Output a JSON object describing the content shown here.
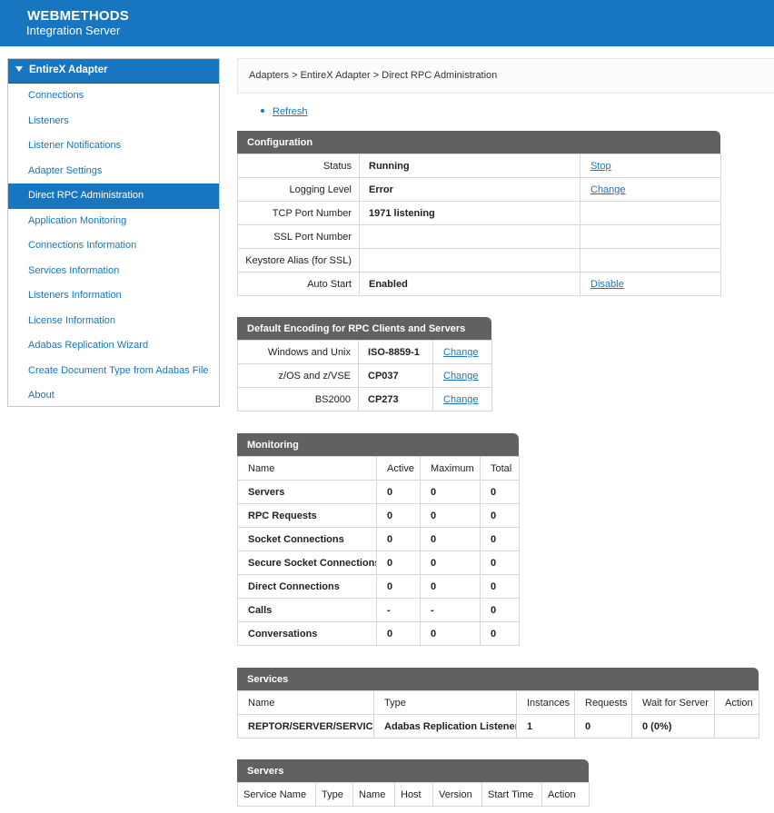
{
  "header": {
    "brand": "WEBMETHODS",
    "product": "Integration Server"
  },
  "sidebar": {
    "title": "EntireX Adapter",
    "items": [
      {
        "label": "Connections"
      },
      {
        "label": "Listeners"
      },
      {
        "label": "Listener Notifications"
      },
      {
        "label": "Adapter Settings"
      },
      {
        "label": "Direct RPC Administration",
        "active": true
      },
      {
        "label": "Application Monitoring"
      },
      {
        "label": "Connections Information"
      },
      {
        "label": "Services Information"
      },
      {
        "label": "Listeners Information"
      },
      {
        "label": "License Information"
      },
      {
        "label": "Adabas Replication Wizard"
      },
      {
        "label": "Create Document Type from Adabas File"
      },
      {
        "label": "About"
      }
    ]
  },
  "breadcrumb": "Adapters > EntireX Adapter > Direct RPC Administration",
  "refresh_label": "Refresh",
  "configuration": {
    "title": "Configuration",
    "rows": [
      {
        "label": "Status",
        "value": "Running",
        "action": "Stop"
      },
      {
        "label": "Logging Level",
        "value": "Error",
        "action": "Change"
      },
      {
        "label": "TCP Port Number",
        "value": "1971 listening",
        "action": ""
      },
      {
        "label": "SSL Port Number",
        "value": "",
        "action": ""
      },
      {
        "label": "Keystore Alias (for SSL)",
        "value": "",
        "action": ""
      },
      {
        "label": "Auto Start",
        "value": "Enabled",
        "action": "Disable"
      }
    ]
  },
  "encoding": {
    "title": "Default Encoding for RPC Clients and Servers",
    "rows": [
      {
        "label": "Windows and Unix",
        "value": "ISO-8859-1",
        "action": "Change"
      },
      {
        "label": "z/OS and z/VSE",
        "value": "CP037",
        "action": "Change"
      },
      {
        "label": "BS2000",
        "value": "CP273",
        "action": "Change"
      }
    ]
  },
  "monitoring": {
    "title": "Monitoring",
    "headers": [
      "Name",
      "Active",
      "Maximum",
      "Total"
    ],
    "rows": [
      [
        "Servers",
        "0",
        "0",
        "0"
      ],
      [
        "RPC Requests",
        "0",
        "0",
        "0"
      ],
      [
        "Socket Connections",
        "0",
        "0",
        "0"
      ],
      [
        "Secure Socket Connections",
        "0",
        "0",
        "0"
      ],
      [
        "Direct Connections",
        "0",
        "0",
        "0"
      ],
      [
        "Calls",
        "-",
        "-",
        "0"
      ],
      [
        "Conversations",
        "0",
        "0",
        "0"
      ]
    ]
  },
  "services": {
    "title": "Services",
    "headers": [
      "Name",
      "Type",
      "Instances",
      "Requests",
      "Wait for Server",
      "Action"
    ],
    "rows": [
      [
        "REPTOR/SERVER/SERVICE",
        "Adabas Replication Listener",
        "1",
        "0",
        "0 (0%)",
        ""
      ]
    ]
  },
  "servers": {
    "title": "Servers",
    "headers": [
      "Service Name",
      "Type",
      "Name",
      "Host",
      "Version",
      "Start Time",
      "Action"
    ]
  }
}
